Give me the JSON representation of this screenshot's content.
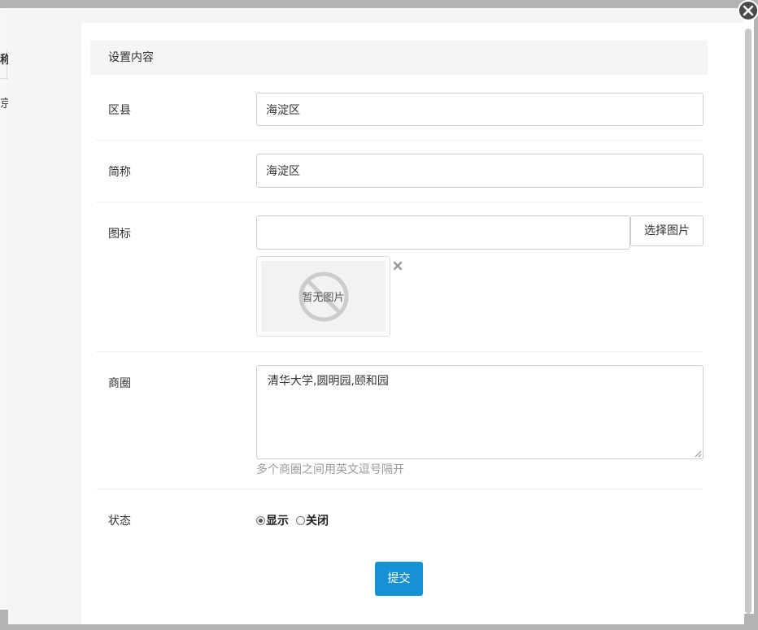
{
  "background": {
    "fragment_top": "称",
    "fragment_bottom": "京"
  },
  "panel": {
    "title": "设置内容"
  },
  "form": {
    "district": {
      "label": "区县",
      "value": "海淀区"
    },
    "short_name": {
      "label": "简称",
      "value": "海淀区"
    },
    "icon": {
      "label": "图标",
      "value": "",
      "select_button": "选择图片",
      "placeholder_image_text": "暂无图片"
    },
    "business_area": {
      "label": "商圈",
      "value": "清华大学,圆明园,颐和园",
      "help": "多个商圈之间用英文逗号隔开"
    },
    "status": {
      "label": "状态",
      "options": [
        {
          "label": "显示",
          "checked": true
        },
        {
          "label": "关闭",
          "checked": false
        }
      ]
    }
  },
  "actions": {
    "submit": "提交"
  },
  "colors": {
    "primary": "#1591d4",
    "overlay": "#b3b3b3"
  }
}
